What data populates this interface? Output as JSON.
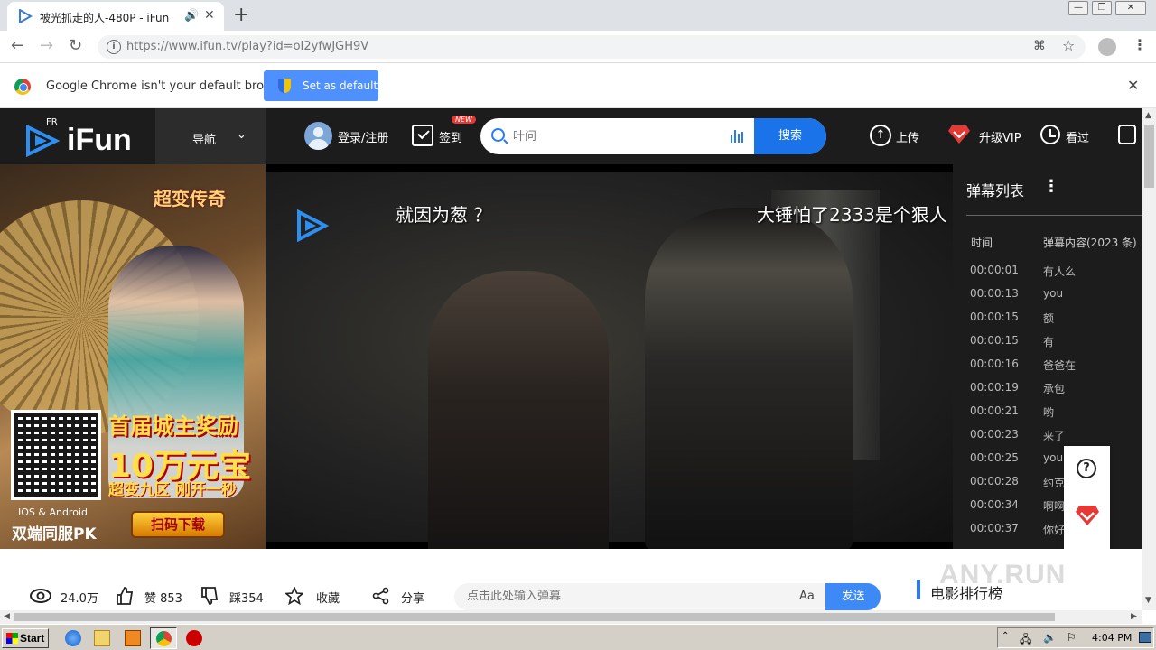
{
  "browser": {
    "tab_title": "被光抓走的人-480P - iFun",
    "tab_close": "✕",
    "new_tab": "+",
    "url": "https://www.ifun.tv/play?id=oI2yfwJGH9V",
    "back": "←",
    "forward": "→",
    "reload": "↻",
    "win_min": "—",
    "win_max": "❐",
    "win_close": "✕"
  },
  "infobar": {
    "message": "Google Chrome isn't your default browser",
    "button": "Set as default",
    "close": "✕"
  },
  "site": {
    "logo_sup": "FR",
    "logo": "iFun",
    "nav": "导航",
    "login": "登录/注册",
    "checkin": "签到",
    "new_badge": "NEW",
    "search_placeholder": "叶问",
    "search_button": "搜索",
    "upload": "上传",
    "vip": "升级VIP",
    "history": "看过"
  },
  "ad": {
    "game_title": "超变传奇",
    "line1": "首届城主奖励",
    "line2": "10万元宝",
    "line3": "超变九区 刚开一秒",
    "download": "扫码下载",
    "platform": "IOS & Android",
    "pk": "双端同服PK"
  },
  "video": {
    "danmaku": [
      "就因为葱 ？",
      "大锤怕了2333是个狠人"
    ]
  },
  "danmaku_panel": {
    "title": "弹幕列表",
    "more": "⋮",
    "col_time": "时间",
    "col_content": "弹幕内容(2023 条)",
    "rows": [
      {
        "time": "00:00:01",
        "text": "有人么"
      },
      {
        "time": "00:00:13",
        "text": "you"
      },
      {
        "time": "00:00:15",
        "text": "额"
      },
      {
        "time": "00:00:15",
        "text": "有"
      },
      {
        "time": "00:00:16",
        "text": "爸爸在"
      },
      {
        "time": "00:00:19",
        "text": "承包"
      },
      {
        "time": "00:00:21",
        "text": "哟"
      },
      {
        "time": "00:00:23",
        "text": "来了"
      },
      {
        "time": "00:00:25",
        "text": "you"
      },
      {
        "time": "00:00:28",
        "text": "约克"
      },
      {
        "time": "00:00:34",
        "text": "啊啊"
      },
      {
        "time": "00:00:37",
        "text": "你好"
      }
    ]
  },
  "widget": {
    "help": "?"
  },
  "actions": {
    "views": "24.0万",
    "likes": "赞 853",
    "dislikes": "踩354",
    "favorite": "收藏",
    "share": "分享",
    "danmaku_placeholder": "点击此处输入弹幕",
    "font": "Aa",
    "send": "发送",
    "rank": "电影排行榜",
    "watermark": "ANY.RUN"
  },
  "taskbar": {
    "start": "Start",
    "clock": "4:04 PM"
  },
  "colors": {
    "accent": "#1a73e8",
    "site_header": "#1c1c1c",
    "vip_red": "#e53935"
  }
}
